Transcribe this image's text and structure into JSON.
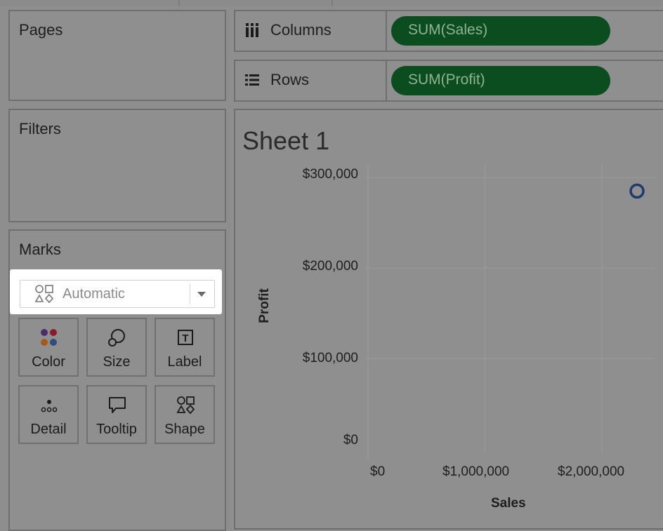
{
  "shelves": {
    "columns": {
      "label": "Columns",
      "pill": "SUM(Sales)",
      "icon": "columns-icon"
    },
    "rows": {
      "label": "Rows",
      "pill": "SUM(Profit)",
      "icon": "rows-icon"
    }
  },
  "cards": {
    "pages": "Pages",
    "filters": "Filters",
    "marks": "Marks"
  },
  "marks": {
    "mark_type": "Automatic",
    "buttons": [
      {
        "label": "Color",
        "icon": "color-icon"
      },
      {
        "label": "Size",
        "icon": "size-icon"
      },
      {
        "label": "Label",
        "icon": "label-icon"
      },
      {
        "label": "Detail",
        "icon": "detail-icon"
      },
      {
        "label": "Tooltip",
        "icon": "tooltip-icon"
      },
      {
        "label": "Shape",
        "icon": "shape-icon"
      }
    ]
  },
  "sheet": {
    "title": "Sheet 1"
  },
  "colors": {
    "pill": "#0b4d1f",
    "pill_text": "#8fb391",
    "mark": "#1f3a6b",
    "background": "#8e8e8e"
  },
  "chart_data": {
    "type": "scatter",
    "x": [
      2300000
    ],
    "y": [
      285000
    ],
    "xlabel": "Sales",
    "ylabel": "Profit",
    "xlim": [
      0,
      2450000
    ],
    "ylim": [
      0,
      310000
    ],
    "xticks": [
      "$0",
      "$1,000,000",
      "$2,000,000"
    ],
    "yticks": [
      "$300,000",
      "$200,000",
      "$100,000",
      "$0"
    ],
    "grid": true
  }
}
